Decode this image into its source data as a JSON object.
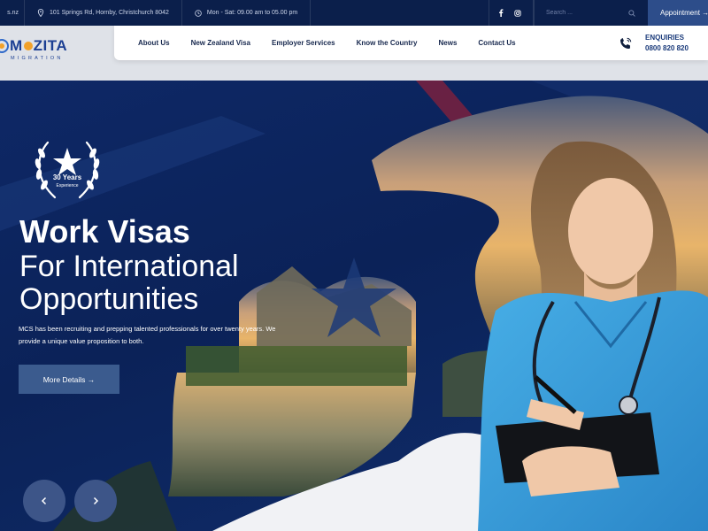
{
  "topbar": {
    "email_fragment": "s.nz",
    "address": "101 Springs Rd, Hornby, Christchurch 8042",
    "hours": "Mon - Sat: 09.00 am to 05.00 pm",
    "social": [
      "facebook-icon",
      "instagram-icon"
    ],
    "search_placeholder": "Search ...",
    "appointment_label": "Appointment →"
  },
  "logo": {
    "name_left": "M",
    "name_right": "ZITA",
    "tagline": "MIGRATION"
  },
  "nav": {
    "items": [
      {
        "label": "About Us"
      },
      {
        "label": "New Zealand Visa"
      },
      {
        "label": "Employer Services"
      },
      {
        "label": "Know the Country"
      },
      {
        "label": "News"
      },
      {
        "label": "Contact Us"
      }
    ]
  },
  "enquiries": {
    "label": "ENQUIRIES",
    "phone": "0800 820 820"
  },
  "hero": {
    "badge_line1": "30 Years",
    "badge_line2": "Experience",
    "title_bold": "Work Visas",
    "title_line2": "For International",
    "title_line3": "Opportunities",
    "description": "MCS has been recruiting and prepping talented professionals for over twenty years. We provide a unique value proposition to both.",
    "cta_label": "More Details →"
  },
  "colors": {
    "topbar": "#0b1f4b",
    "hero_bg": "#0c2356",
    "accent_blue": "#1c3f93",
    "cta": "#3b5b8e",
    "scrub_blue": "#3a9bd8"
  }
}
